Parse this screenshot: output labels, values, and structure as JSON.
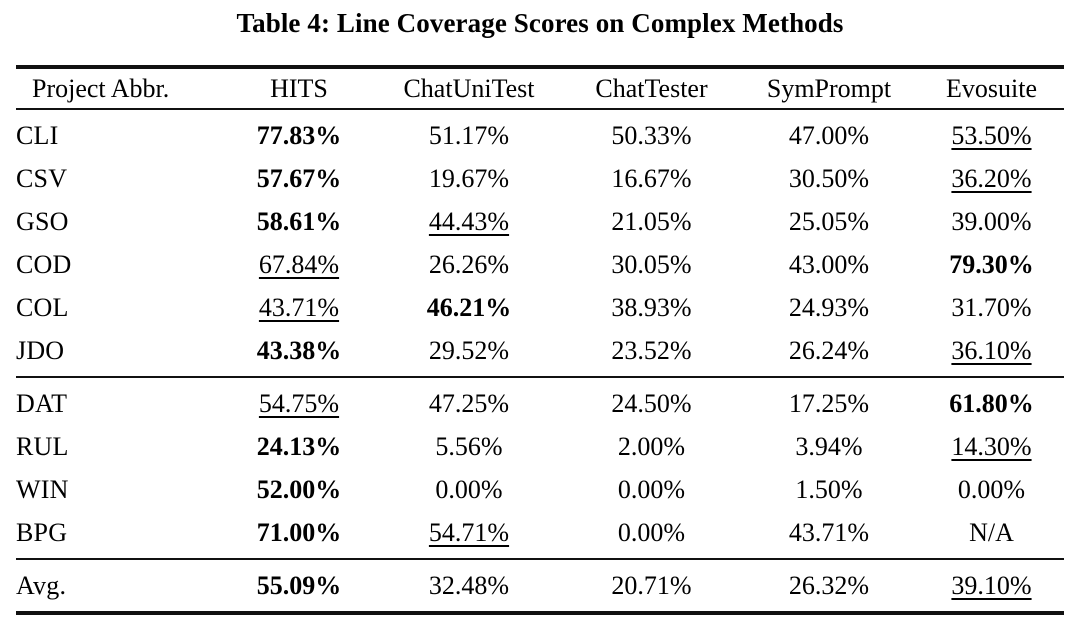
{
  "title": "Table 4: Line Coverage Scores on Complex Methods",
  "table": {
    "columns": [
      {
        "key": "project",
        "label": "Project Abbr."
      },
      {
        "key": "hits",
        "label": "HITS"
      },
      {
        "key": "chatunitest",
        "label": "ChatUniTest"
      },
      {
        "key": "chattester",
        "label": "ChatTester"
      },
      {
        "key": "symprompt",
        "label": "SymPrompt"
      },
      {
        "key": "evosuite",
        "label": "Evosuite"
      }
    ],
    "groups": [
      {
        "rows": [
          {
            "project": "CLI",
            "hits": "77.83%",
            "hits_style": "bold",
            "chatunitest": "51.17%",
            "chatunitest_style": "",
            "chattester": "50.33%",
            "chattester_style": "",
            "symprompt": "47.00%",
            "symprompt_style": "",
            "evosuite": "53.50%",
            "evosuite_style": "underline"
          },
          {
            "project": "CSV",
            "hits": "57.67%",
            "hits_style": "bold",
            "chatunitest": "19.67%",
            "chatunitest_style": "",
            "chattester": "16.67%",
            "chattester_style": "",
            "symprompt": "30.50%",
            "symprompt_style": "",
            "evosuite": "36.20%",
            "evosuite_style": "underline"
          },
          {
            "project": "GSO",
            "hits": "58.61%",
            "hits_style": "bold",
            "chatunitest": "44.43%",
            "chatunitest_style": "underline",
            "chattester": "21.05%",
            "chattester_style": "",
            "symprompt": "25.05%",
            "symprompt_style": "",
            "evosuite": "39.00%",
            "evosuite_style": ""
          },
          {
            "project": "COD",
            "hits": "67.84%",
            "hits_style": "underline",
            "chatunitest": "26.26%",
            "chatunitest_style": "",
            "chattester": "30.05%",
            "chattester_style": "",
            "symprompt": "43.00%",
            "symprompt_style": "",
            "evosuite": "79.30%",
            "evosuite_style": "bold"
          },
          {
            "project": "COL",
            "hits": "43.71%",
            "hits_style": "underline",
            "chatunitest": "46.21%",
            "chatunitest_style": "bold",
            "chattester": "38.93%",
            "chattester_style": "",
            "symprompt": "24.93%",
            "symprompt_style": "",
            "evosuite": "31.70%",
            "evosuite_style": ""
          },
          {
            "project": "JDO",
            "hits": "43.38%",
            "hits_style": "bold",
            "chatunitest": "29.52%",
            "chatunitest_style": "",
            "chattester": "23.52%",
            "chattester_style": "",
            "symprompt": "26.24%",
            "symprompt_style": "",
            "evosuite": "36.10%",
            "evosuite_style": "underline"
          }
        ]
      },
      {
        "rows": [
          {
            "project": "DAT",
            "hits": "54.75%",
            "hits_style": "underline",
            "chatunitest": "47.25%",
            "chatunitest_style": "",
            "chattester": "24.50%",
            "chattester_style": "",
            "symprompt": "17.25%",
            "symprompt_style": "",
            "evosuite": "61.80%",
            "evosuite_style": "bold"
          },
          {
            "project": "RUL",
            "hits": "24.13%",
            "hits_style": "bold",
            "chatunitest": "5.56%",
            "chatunitest_style": "",
            "chattester": "2.00%",
            "chattester_style": "",
            "symprompt": "3.94%",
            "symprompt_style": "",
            "evosuite": "14.30%",
            "evosuite_style": "underline"
          },
          {
            "project": "WIN",
            "hits": "52.00%",
            "hits_style": "bold",
            "chatunitest": "0.00%",
            "chatunitest_style": "",
            "chattester": "0.00%",
            "chattester_style": "",
            "symprompt": "1.50%",
            "symprompt_style": "",
            "evosuite": "0.00%",
            "evosuite_style": ""
          },
          {
            "project": "BPG",
            "hits": "71.00%",
            "hits_style": "bold",
            "chatunitest": "54.71%",
            "chatunitest_style": "underline",
            "chattester": "0.00%",
            "chattester_style": "",
            "symprompt": "43.71%",
            "symprompt_style": "",
            "evosuite": "N/A",
            "evosuite_style": ""
          }
        ]
      }
    ],
    "summary": {
      "project": "Avg.",
      "hits": "55.09%",
      "hits_style": "bold",
      "chatunitest": "32.48%",
      "chatunitest_style": "",
      "chattester": "20.71%",
      "chattester_style": "",
      "symprompt": "26.32%",
      "symprompt_style": "",
      "evosuite": "39.10%",
      "evosuite_style": "underline"
    }
  }
}
